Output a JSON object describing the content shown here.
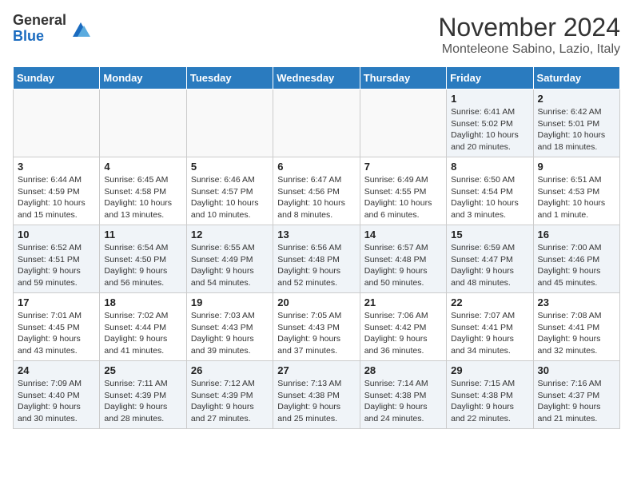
{
  "header": {
    "logo_general": "General",
    "logo_blue": "Blue",
    "month": "November 2024",
    "location": "Monteleone Sabino, Lazio, Italy"
  },
  "days_of_week": [
    "Sunday",
    "Monday",
    "Tuesday",
    "Wednesday",
    "Thursday",
    "Friday",
    "Saturday"
  ],
  "weeks": [
    [
      {
        "day": "",
        "info": ""
      },
      {
        "day": "",
        "info": ""
      },
      {
        "day": "",
        "info": ""
      },
      {
        "day": "",
        "info": ""
      },
      {
        "day": "",
        "info": ""
      },
      {
        "day": "1",
        "info": "Sunrise: 6:41 AM\nSunset: 5:02 PM\nDaylight: 10 hours and 20 minutes."
      },
      {
        "day": "2",
        "info": "Sunrise: 6:42 AM\nSunset: 5:01 PM\nDaylight: 10 hours and 18 minutes."
      }
    ],
    [
      {
        "day": "3",
        "info": "Sunrise: 6:44 AM\nSunset: 4:59 PM\nDaylight: 10 hours and 15 minutes."
      },
      {
        "day": "4",
        "info": "Sunrise: 6:45 AM\nSunset: 4:58 PM\nDaylight: 10 hours and 13 minutes."
      },
      {
        "day": "5",
        "info": "Sunrise: 6:46 AM\nSunset: 4:57 PM\nDaylight: 10 hours and 10 minutes."
      },
      {
        "day": "6",
        "info": "Sunrise: 6:47 AM\nSunset: 4:56 PM\nDaylight: 10 hours and 8 minutes."
      },
      {
        "day": "7",
        "info": "Sunrise: 6:49 AM\nSunset: 4:55 PM\nDaylight: 10 hours and 6 minutes."
      },
      {
        "day": "8",
        "info": "Sunrise: 6:50 AM\nSunset: 4:54 PM\nDaylight: 10 hours and 3 minutes."
      },
      {
        "day": "9",
        "info": "Sunrise: 6:51 AM\nSunset: 4:53 PM\nDaylight: 10 hours and 1 minute."
      }
    ],
    [
      {
        "day": "10",
        "info": "Sunrise: 6:52 AM\nSunset: 4:51 PM\nDaylight: 9 hours and 59 minutes."
      },
      {
        "day": "11",
        "info": "Sunrise: 6:54 AM\nSunset: 4:50 PM\nDaylight: 9 hours and 56 minutes."
      },
      {
        "day": "12",
        "info": "Sunrise: 6:55 AM\nSunset: 4:49 PM\nDaylight: 9 hours and 54 minutes."
      },
      {
        "day": "13",
        "info": "Sunrise: 6:56 AM\nSunset: 4:48 PM\nDaylight: 9 hours and 52 minutes."
      },
      {
        "day": "14",
        "info": "Sunrise: 6:57 AM\nSunset: 4:48 PM\nDaylight: 9 hours and 50 minutes."
      },
      {
        "day": "15",
        "info": "Sunrise: 6:59 AM\nSunset: 4:47 PM\nDaylight: 9 hours and 48 minutes."
      },
      {
        "day": "16",
        "info": "Sunrise: 7:00 AM\nSunset: 4:46 PM\nDaylight: 9 hours and 45 minutes."
      }
    ],
    [
      {
        "day": "17",
        "info": "Sunrise: 7:01 AM\nSunset: 4:45 PM\nDaylight: 9 hours and 43 minutes."
      },
      {
        "day": "18",
        "info": "Sunrise: 7:02 AM\nSunset: 4:44 PM\nDaylight: 9 hours and 41 minutes."
      },
      {
        "day": "19",
        "info": "Sunrise: 7:03 AM\nSunset: 4:43 PM\nDaylight: 9 hours and 39 minutes."
      },
      {
        "day": "20",
        "info": "Sunrise: 7:05 AM\nSunset: 4:43 PM\nDaylight: 9 hours and 37 minutes."
      },
      {
        "day": "21",
        "info": "Sunrise: 7:06 AM\nSunset: 4:42 PM\nDaylight: 9 hours and 36 minutes."
      },
      {
        "day": "22",
        "info": "Sunrise: 7:07 AM\nSunset: 4:41 PM\nDaylight: 9 hours and 34 minutes."
      },
      {
        "day": "23",
        "info": "Sunrise: 7:08 AM\nSunset: 4:41 PM\nDaylight: 9 hours and 32 minutes."
      }
    ],
    [
      {
        "day": "24",
        "info": "Sunrise: 7:09 AM\nSunset: 4:40 PM\nDaylight: 9 hours and 30 minutes."
      },
      {
        "day": "25",
        "info": "Sunrise: 7:11 AM\nSunset: 4:39 PM\nDaylight: 9 hours and 28 minutes."
      },
      {
        "day": "26",
        "info": "Sunrise: 7:12 AM\nSunset: 4:39 PM\nDaylight: 9 hours and 27 minutes."
      },
      {
        "day": "27",
        "info": "Sunrise: 7:13 AM\nSunset: 4:38 PM\nDaylight: 9 hours and 25 minutes."
      },
      {
        "day": "28",
        "info": "Sunrise: 7:14 AM\nSunset: 4:38 PM\nDaylight: 9 hours and 24 minutes."
      },
      {
        "day": "29",
        "info": "Sunrise: 7:15 AM\nSunset: 4:38 PM\nDaylight: 9 hours and 22 minutes."
      },
      {
        "day": "30",
        "info": "Sunrise: 7:16 AM\nSunset: 4:37 PM\nDaylight: 9 hours and 21 minutes."
      }
    ]
  ]
}
